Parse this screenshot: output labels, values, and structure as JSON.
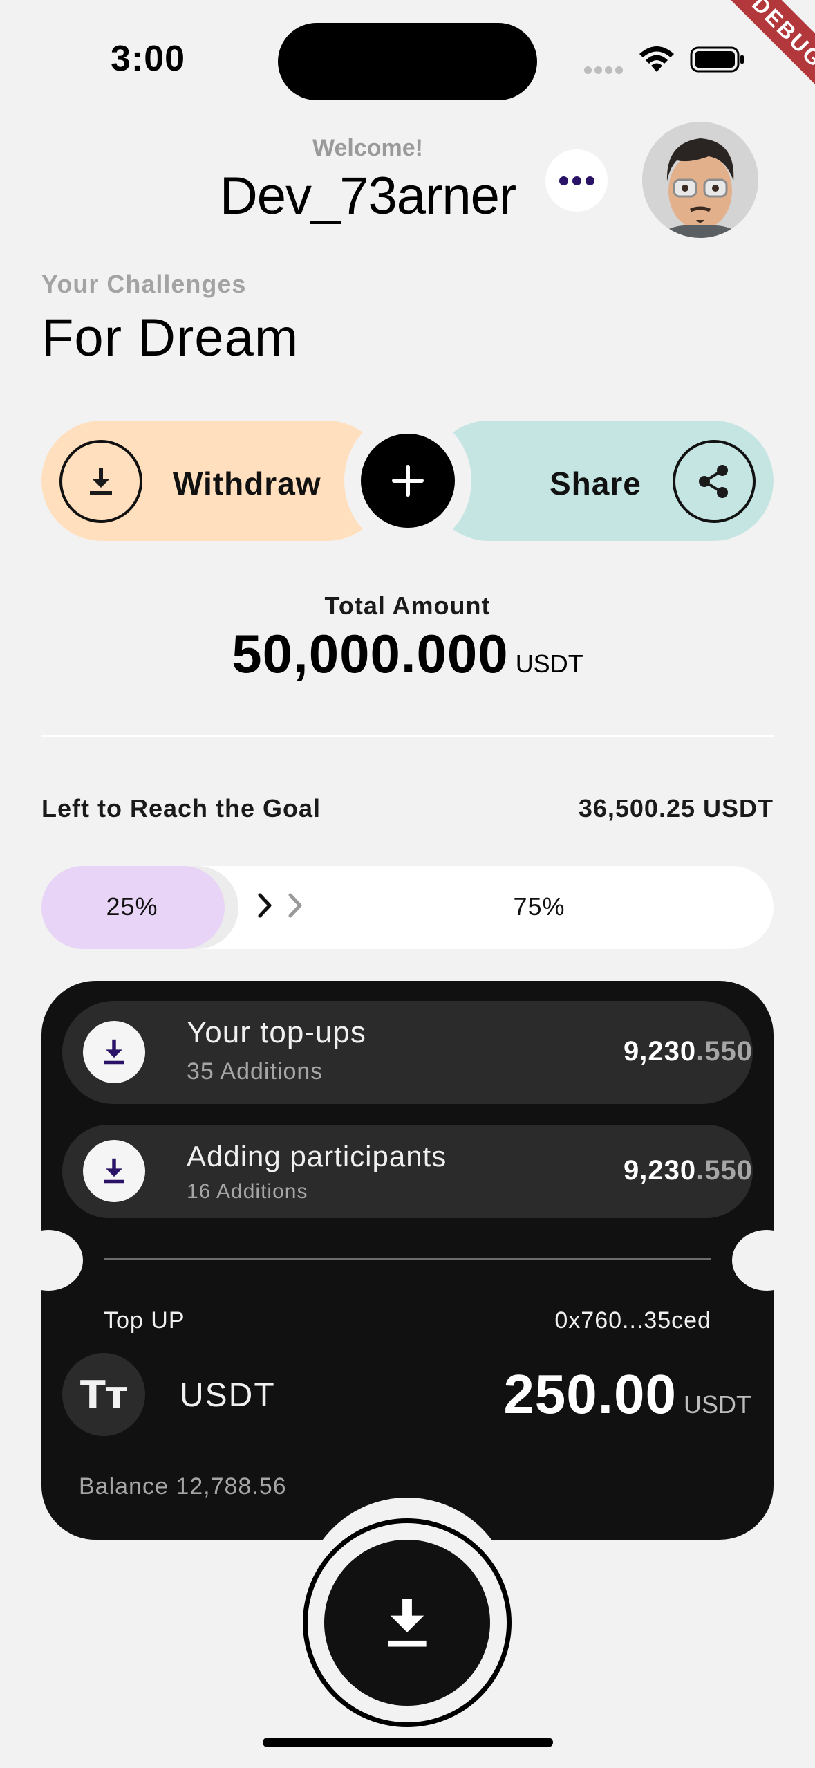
{
  "status_bar": {
    "time": "3:00",
    "debug_label": "DEBUG"
  },
  "header": {
    "welcome": "Welcome!",
    "username": "Dev_73arner"
  },
  "challenge": {
    "section_label": "Your Challenges",
    "title": "For Dream"
  },
  "actions": {
    "withdraw_label": "Withdraw",
    "share_label": "Share"
  },
  "total": {
    "label": "Total Amount",
    "value": "50,000.000",
    "unit": "USDT"
  },
  "goal": {
    "label": "Left to Reach the Goal",
    "value": "36,500.25 USDT"
  },
  "progress": {
    "completed_label": "25%",
    "remaining_label": "75%",
    "completed_fraction": 0.25
  },
  "card": {
    "rows": [
      {
        "title": "Your top-ups",
        "subtitle": "35 Additions",
        "amount_main": "9,230",
        "amount_decimal": ".550",
        "icon": "download-icon"
      },
      {
        "title": "Adding participants",
        "subtitle": "16 Additions",
        "amount_main": "9,230",
        "amount_decimal": ".550",
        "icon": "download-icon"
      }
    ],
    "topup_label": "Top UP",
    "address": "0x760...35ced",
    "token_symbol_icon": "Tт",
    "token_name": "USDT",
    "amount": "250.00",
    "amount_unit": "USDT",
    "balance": "Balance 12,788.56"
  },
  "colors": {
    "background": "#f2f2f2",
    "withdraw_pill": "#ffdfbd",
    "share_pill": "#c5e5e3",
    "progress_fill": "#e8d4f6",
    "card": "#111111",
    "card_row": "#2b2b2b",
    "accent_icon": "#2a1366",
    "debug_ribbon": "#b2383c"
  }
}
